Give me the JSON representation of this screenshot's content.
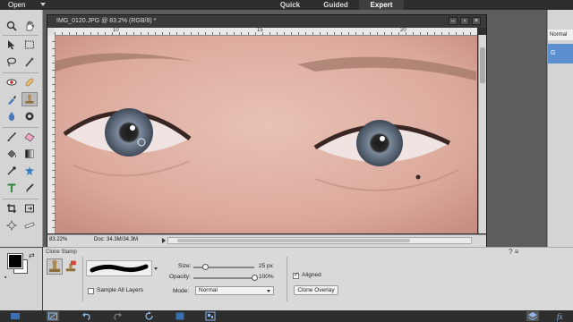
{
  "topbar": {
    "open_label": "Open",
    "modes": {
      "quick": "Quick",
      "guided": "Guided",
      "expert": "Expert"
    }
  },
  "document": {
    "title": "IMG_0120.JPG @ 83.2% (RGB/8) *",
    "ruler_marks": [
      "10",
      "15",
      "20"
    ],
    "status_zoom": "83.22%",
    "status_doc": "Doc: 34.3M/34.3M"
  },
  "layers_panel": {
    "blend_mode": "Normal",
    "layer_label": "G"
  },
  "tool_options": {
    "tool_name": "Clone Stamp",
    "size_label": "Size:",
    "size_value": "25 px",
    "size_level": 0.2,
    "opacity_label": "Opacity:",
    "opacity_value": "100%",
    "opacity_level": 1.0,
    "mode_label": "Mode:",
    "mode_value": "Normal",
    "sample_all_layers_label": "Sample All Layers",
    "sample_all_layers_checked": false,
    "aligned_label": "Aligned",
    "aligned_checked": true,
    "clone_overlay_label": "Clone Overlay"
  },
  "colors": {
    "foreground": "#000000",
    "background": "#ffffff",
    "accent": "#5b8fd0"
  },
  "tools": [
    "zoom-icon",
    "hand-icon",
    "move-icon",
    "marquee-icon",
    "lasso-icon",
    "magic-wand-icon",
    "red-eye-icon",
    "spot-healing-icon",
    "smart-brush-icon",
    "clone-stamp-icon",
    "blur-icon",
    "sponge-icon",
    "brush-icon",
    "eraser-icon",
    "paint-bucket-icon",
    "gradient-icon",
    "eyedropper-icon",
    "custom-shape-icon",
    "type-icon",
    "pencil-icon",
    "crop-icon",
    "recompose-icon",
    "content-aware-move-icon",
    "straighten-icon"
  ]
}
